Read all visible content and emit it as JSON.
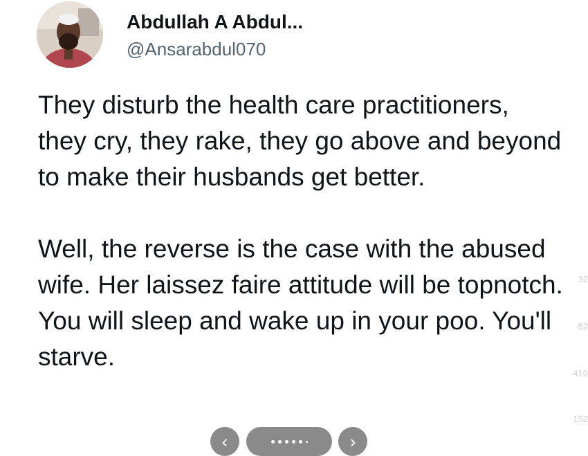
{
  "author": {
    "display_name": "Abdullah A Abdul...",
    "handle": "@Ansarabdul070",
    "avatar_icon": "profile-photo"
  },
  "tweet": {
    "paragraph_1": "They disturb the health care practitioners, they cry, they rake, they go above and beyond to make their husbands get better.",
    "paragraph_2": "Well, the reverse is the case with the abused wife. Her laissez faire attitude will be topnotch. You will sleep and wake up in your poo. You'll starve."
  },
  "sidebar_faint": {
    "count_1": "32",
    "count_2": "82",
    "count_3": "410",
    "count_4": "152"
  },
  "carousel": {
    "prev_icon": "‹",
    "next_icon": "›"
  },
  "colors": {
    "text": "#0f1419",
    "handle": "#536471",
    "nav_button": "#8a8a8a"
  }
}
